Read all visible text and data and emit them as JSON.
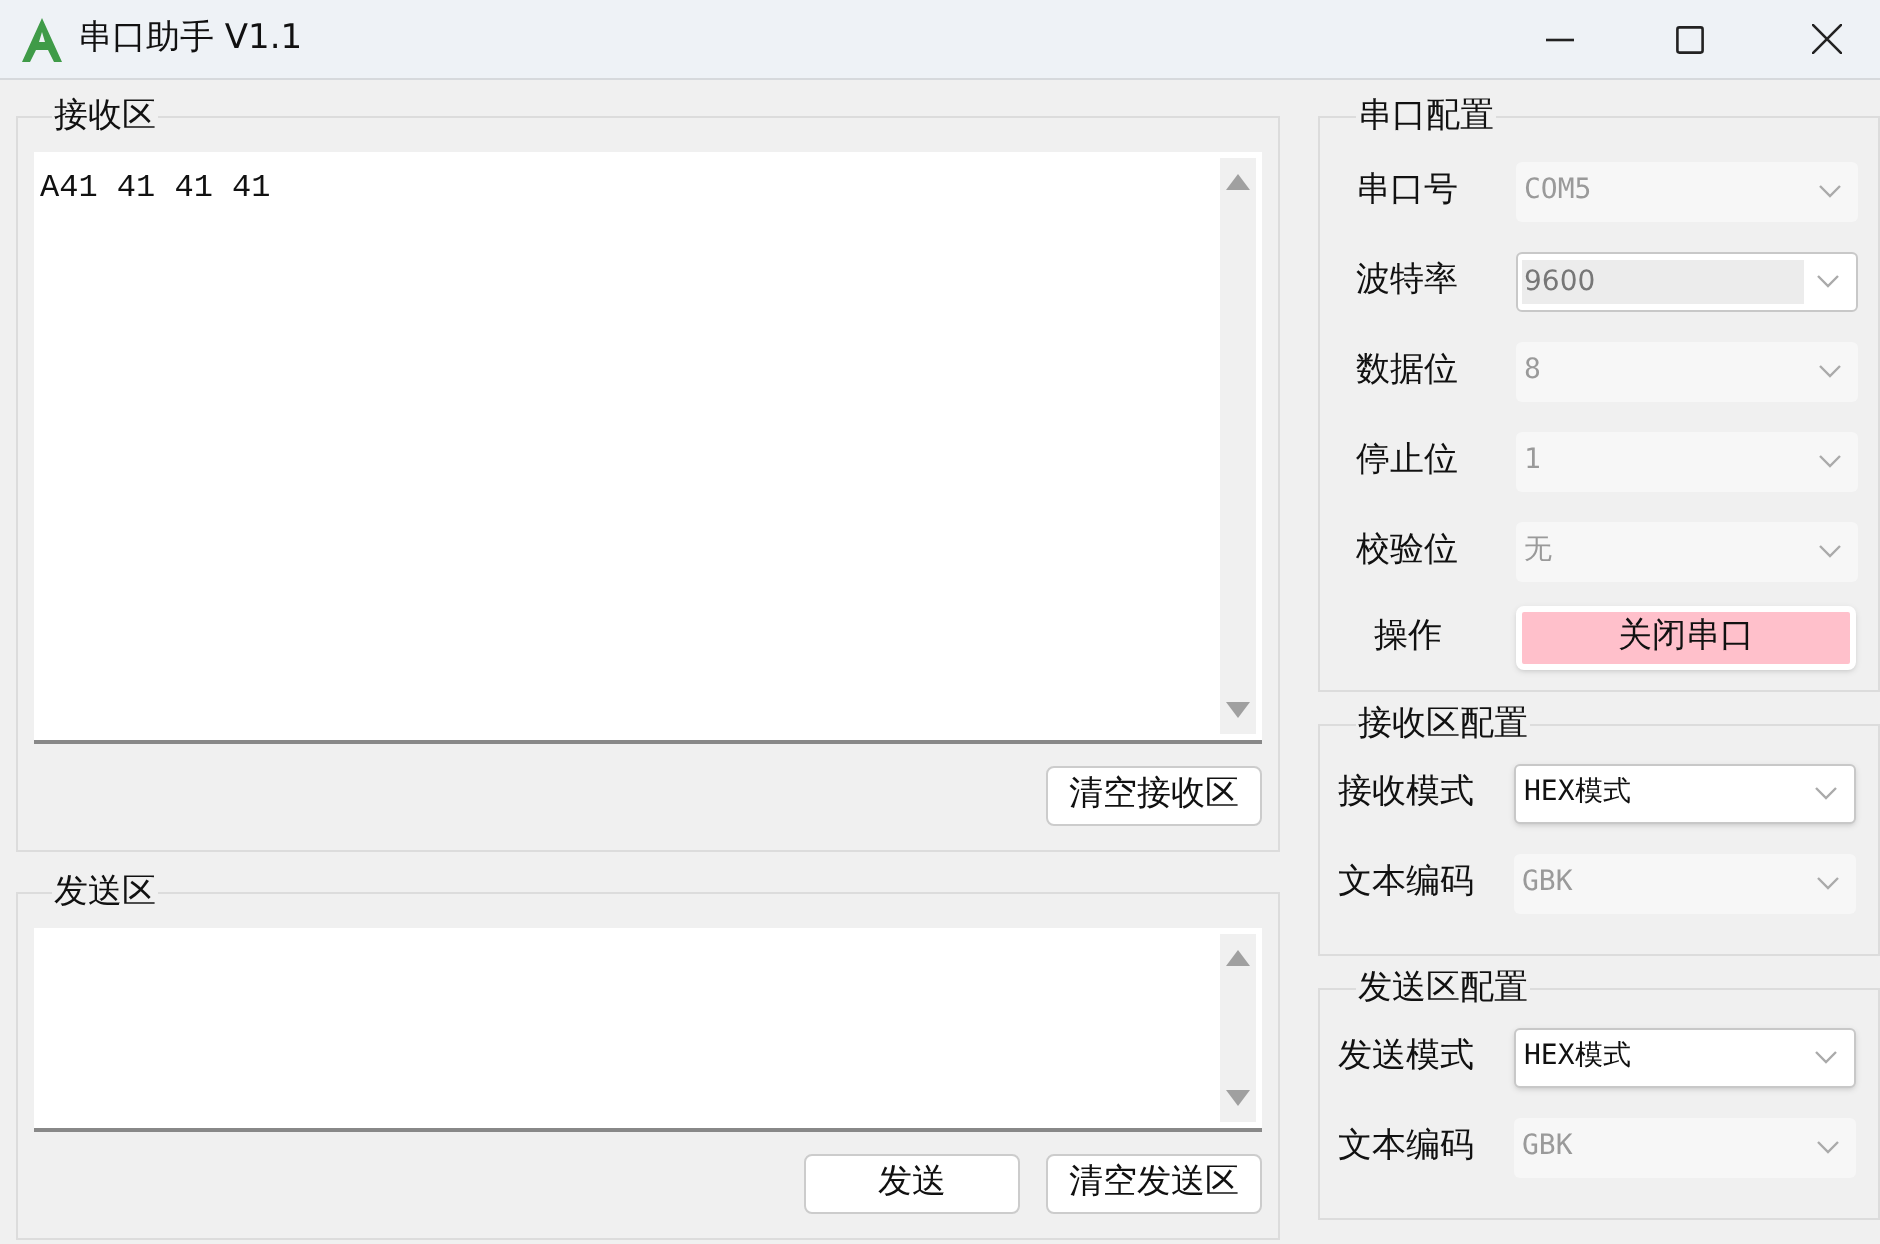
{
  "window": {
    "title": "串口助手 V1.1"
  },
  "receive": {
    "title": "接收区",
    "text": "A41 41 41 41",
    "clear_button": "清空接收区"
  },
  "send": {
    "title": "发送区",
    "buttons": [
      "发送",
      "清空发送区"
    ]
  },
  "serial_config": {
    "title": "串口配置",
    "fields": [
      {
        "label": "串口号",
        "value": "COM5",
        "kind": "combo",
        "disabled": true
      },
      {
        "label": "波特率",
        "value": "9600",
        "kind": "editable",
        "disabled": true
      },
      {
        "label": "数据位",
        "value": "8",
        "kind": "combo",
        "disabled": true
      },
      {
        "label": "停止位",
        "value": "1",
        "kind": "combo",
        "disabled": true
      },
      {
        "label": "校验位",
        "value": "无",
        "kind": "combo",
        "disabled": true
      }
    ],
    "action": {
      "label": "操作",
      "button": "关闭串口"
    }
  },
  "receive_config": {
    "title": "接收区配置",
    "fields": [
      {
        "label": "接收模式",
        "value": "HEX模式",
        "kind": "combo",
        "disabled": false
      },
      {
        "label": "文本编码",
        "value": "GBK",
        "kind": "combo",
        "disabled": true
      }
    ]
  },
  "send_config": {
    "title": "发送区配置",
    "fields": [
      {
        "label": "发送模式",
        "value": "HEX模式",
        "kind": "combo",
        "disabled": false
      },
      {
        "label": "文本编码",
        "value": "GBK",
        "kind": "combo",
        "disabled": true
      }
    ]
  }
}
